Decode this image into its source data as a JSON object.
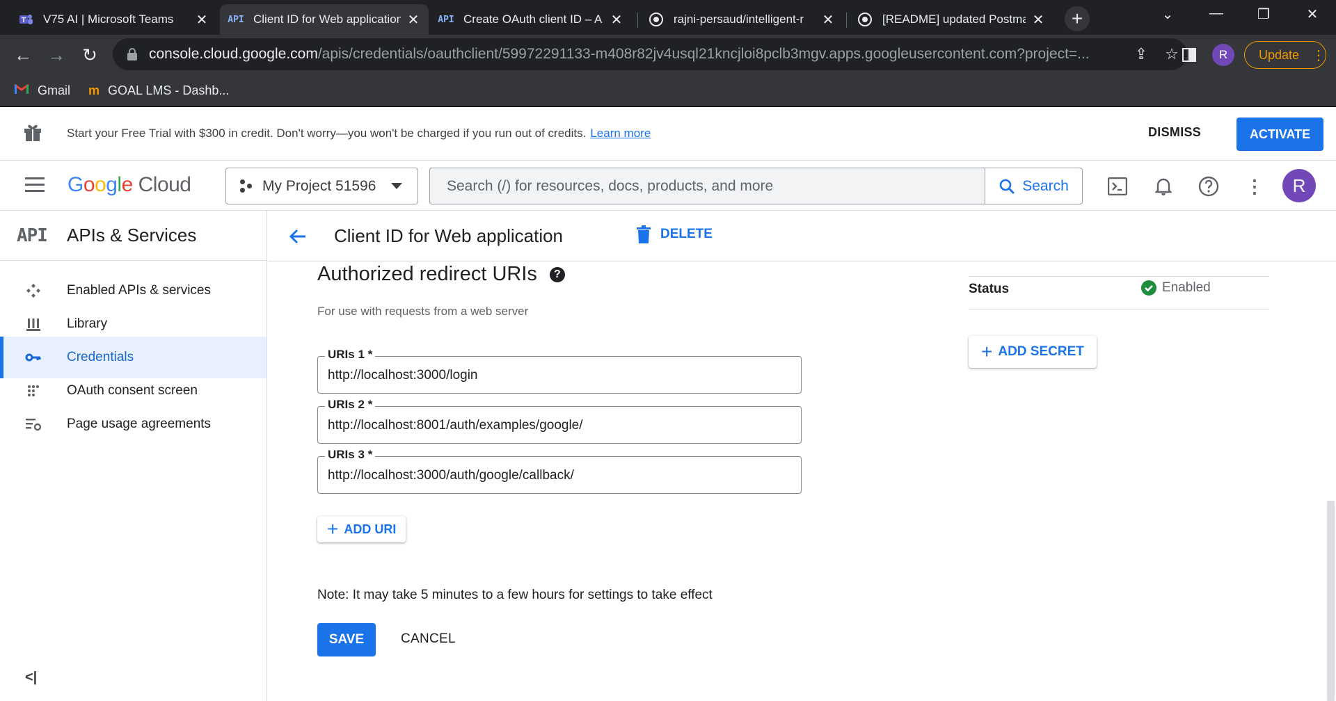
{
  "browser": {
    "tabs": [
      {
        "title": "V75 AI | Microsoft Teams",
        "icon": "teams-icon"
      },
      {
        "title": "Client ID for Web application",
        "icon": "api-icon"
      },
      {
        "title": "Create OAuth client ID – A",
        "icon": "api-icon"
      },
      {
        "title": "rajni-persaud/intelligent-r",
        "icon": "github-icon"
      },
      {
        "title": "[README] updated Postma",
        "icon": "github-icon"
      }
    ],
    "api_favicon_text": "API",
    "url_host": "console.cloud.google.com",
    "url_path": "/apis/credentials/oauthclient/59972291133-m408r82jv4usql21kncjloi8pclb3mgv.apps.googleusercontent.com?project=...",
    "profile_initial": "R",
    "update_label": "Update",
    "bookmarks": [
      {
        "label": "Gmail",
        "icon": "gmail-icon"
      },
      {
        "label": "GOAL LMS - Dashb...",
        "icon": "goal-lms-icon"
      }
    ]
  },
  "banner": {
    "text": "Start your Free Trial with $300 in credit. Don't worry—you won't be charged if you run out of credits.",
    "learn_more": "Learn more",
    "dismiss": "DISMISS",
    "activate": "ACTIVATE"
  },
  "header": {
    "logo_google": "Google",
    "logo_cloud": "Cloud",
    "project": "My Project 51596",
    "search_placeholder": "Search (/) for resources, docs, products, and more",
    "search_button": "Search",
    "avatar_initial": "R"
  },
  "sidebar": {
    "logo": "API",
    "title": "APIs & Services",
    "items": [
      {
        "label": "Enabled APIs & services",
        "icon": "enabled-apis-icon"
      },
      {
        "label": "Library",
        "icon": "library-icon"
      },
      {
        "label": "Credentials",
        "icon": "key-icon"
      },
      {
        "label": "OAuth consent screen",
        "icon": "consent-screen-icon"
      },
      {
        "label": "Page usage agreements",
        "icon": "settings-list-icon"
      }
    ],
    "active_index": 2,
    "collapse": "<|"
  },
  "page": {
    "title": "Client ID for Web application",
    "delete": "DELETE"
  },
  "main": {
    "section_title": "Authorized redirect URIs",
    "section_subtitle": "For use with requests from a web server",
    "uris": [
      {
        "label": "URIs 1 *",
        "value": "http://localhost:3000/login"
      },
      {
        "label": "URIs 2 *",
        "value": "http://localhost:8001/auth/examples/google/"
      },
      {
        "label": "URIs 3 *",
        "value": "http://localhost:3000/auth/google/callback/"
      }
    ],
    "add_uri": "ADD URI",
    "note": "Note: It may take 5 minutes to a few hours for settings to take effect",
    "save": "SAVE",
    "cancel": "CANCEL"
  },
  "secrets": {
    "status_label": "Status",
    "status_value": "Enabled",
    "add_secret": "ADD SECRET"
  },
  "colors": {
    "accent": "#1a73e8",
    "enabled_green": "#1e8e3e",
    "avatar": "#7248b9",
    "update": "#f29900"
  }
}
